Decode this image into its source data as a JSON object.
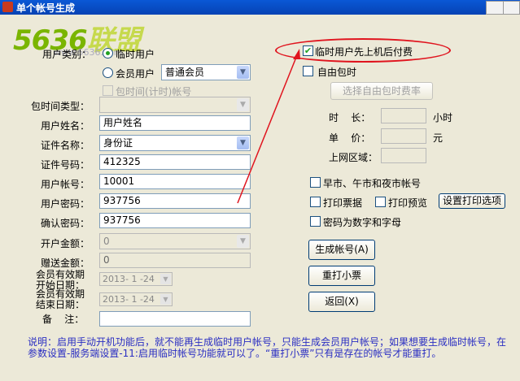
{
  "window": {
    "title": "单个帐号生成"
  },
  "watermark": {
    "num": "5636",
    "cn": "联盟",
    "sub": "www.5636.com"
  },
  "form": {
    "user_type_label": "用户类别：",
    "radio_temp": "临时用户",
    "radio_member": "会员用户",
    "member_level": "普通会员",
    "time_package_label": "包时间(计时)帐号",
    "package_type_label": "包时间类型：",
    "package_type_value": "",
    "username_label": "用户姓名：",
    "username_value": "用户姓名",
    "id_type_label": "证件名称：",
    "id_type_value": "身份证",
    "id_number_label": "证件号码：",
    "id_number_value": "412325",
    "account_label": "用户帐号：",
    "account_value": "10001",
    "password_label": "用户密码：",
    "password_value": "937756",
    "confirm_label": "确认密码：",
    "confirm_value": "937756",
    "balance_label": "开户金额：",
    "balance_value": "0",
    "gift_label": "赠送金额：",
    "gift_value": "0",
    "start_label_1": "会员有效期",
    "start_label_2": "开始日期：",
    "start_date": "2013- 1 -24",
    "end_label_1": "会员有效期",
    "end_label_2": "结束日期：",
    "end_date": "2013- 1 -24",
    "remark_label": "备    注：",
    "remark_value": ""
  },
  "right": {
    "cb_temp_first": "临时用户先上机后付费",
    "cb_free_package": "自由包时",
    "btn_select_rate": "选择自由包时费率",
    "duration_label": "时    长：",
    "duration_unit": "小时",
    "price_label": "单    价：",
    "price_unit": "元",
    "area_label": "上网区域：",
    "cb_shift": "早市、午市和夜市帐号",
    "cb_print_ticket": "打印票据",
    "cb_print_preview": "打印预览",
    "btn_print_options": "设置打印选项",
    "cb_pwd_alnum": "密码为数字和字母",
    "btn_generate": "生成帐号(A)",
    "btn_reprint": "重打小票",
    "btn_back": "返回(X)"
  },
  "note": "说明：启用手动开机功能后，就不能再生成临时用户帐号，只能生成会员用户帐号；如果想要生成临时帐号，在参数设置-服务端设置-11:启用临时帐号功能就可以了。“重打小票”只有是存在的帐号才能重打。"
}
